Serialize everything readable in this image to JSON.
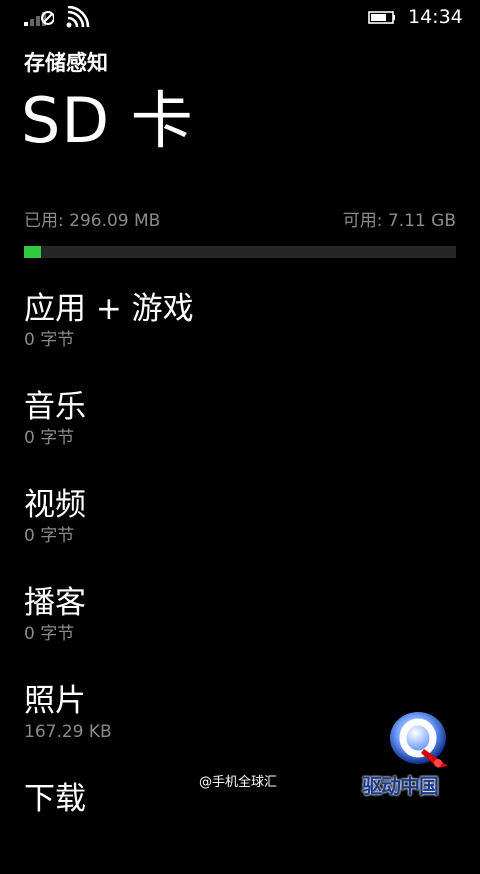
{
  "status_bar": {
    "time": "14:34",
    "icons": [
      "no-signal-icon",
      "wifi-icon",
      "battery-icon"
    ]
  },
  "header": {
    "app_title": "存储感知",
    "page_title": "SD 卡"
  },
  "storage": {
    "used_label": "已用: 296.09 MB",
    "free_label": "可用: 7.11 GB",
    "used_fraction": 0.039,
    "bar_fill_color": "#2ecc40",
    "bar_track_color": "#262626"
  },
  "categories": [
    {
      "name": "应用 + 游戏",
      "size": "0 字节"
    },
    {
      "name": "音乐",
      "size": "0 字节"
    },
    {
      "name": "视频",
      "size": "0 字节"
    },
    {
      "name": "播客",
      "size": "0 字节"
    },
    {
      "name": "照片",
      "size": "167.29 KB"
    },
    {
      "name": "下载",
      "size": ""
    }
  ],
  "watermark": {
    "text": "@手机全球汇",
    "logo_caption": "驱动中国"
  },
  "colors": {
    "background": "#000000",
    "primary_text": "#ffffff",
    "secondary_text": "#8a8a8a"
  }
}
